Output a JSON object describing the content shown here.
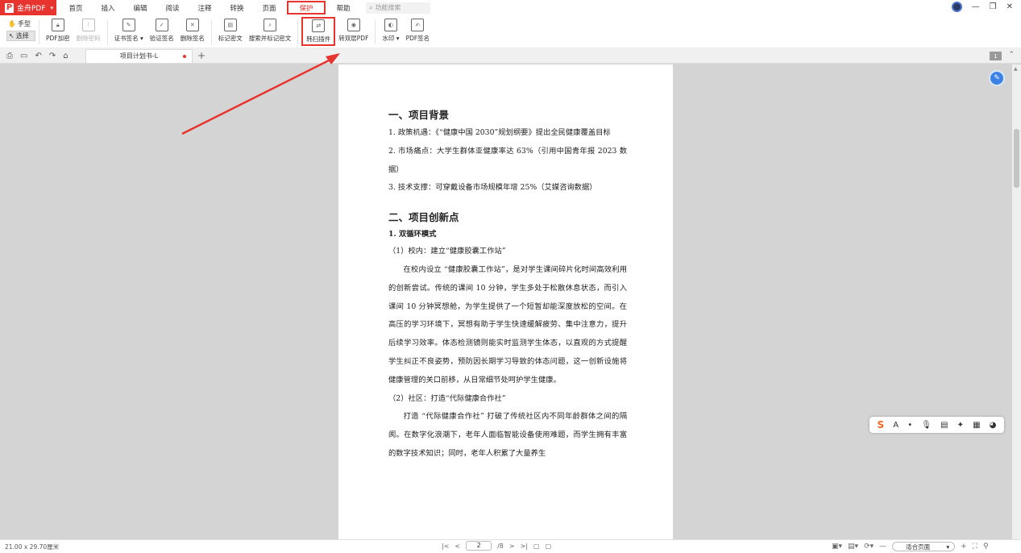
{
  "app": {
    "name": "金舟PDF",
    "logo_letter": "P"
  },
  "menu": {
    "tabs": [
      "首页",
      "插入",
      "编辑",
      "阅读",
      "注释",
      "转换",
      "页面",
      "保护",
      "帮助"
    ],
    "active": "保护",
    "search_placeholder": "功能搜索"
  },
  "ribbon": {
    "hand_label": "手型",
    "select_label": "选择",
    "buttons": [
      {
        "label": "PDF加密",
        "icon": "lock-shield-icon",
        "enabled": true
      },
      {
        "label": "删除密码",
        "icon": "unlock-shield-icon",
        "enabled": false
      },
      {
        "label": "证书签名",
        "icon": "certificate-sign-icon",
        "enabled": true,
        "dropdown": true
      },
      {
        "label": "验证签名",
        "icon": "verify-signature-icon",
        "enabled": true
      },
      {
        "label": "删除签名",
        "icon": "delete-signature-icon",
        "enabled": true
      },
      {
        "label": "标记密文",
        "icon": "mark-redaction-icon",
        "enabled": true
      },
      {
        "label": "搜索并标记密文",
        "icon": "search-redaction-icon",
        "enabled": true
      },
      {
        "label": "韩扫插件",
        "icon": "scan-plugin-icon",
        "enabled": true,
        "highlighted": true
      },
      {
        "label": "转双层PDF",
        "icon": "double-layer-pdf-icon",
        "enabled": true
      },
      {
        "label": "水印",
        "icon": "watermark-icon",
        "enabled": true,
        "dropdown": true
      },
      {
        "label": "PDF签名",
        "icon": "pdf-sign-icon",
        "enabled": true
      }
    ]
  },
  "tabs": {
    "document_title": "项目计划书-L",
    "modified": true,
    "page_count_badge": "1"
  },
  "document": {
    "sections": [
      {
        "heading": "一、项目背景",
        "blocks": [
          {
            "type": "p",
            "text": "1. 政策机遇：《“健康中国 2030”规划纲要》提出全民健康覆盖目标"
          },
          {
            "type": "p",
            "text": "2. 市场痛点：大学生群体亚健康率达 63%（引用中国青年报 2023 数据）"
          },
          {
            "type": "p",
            "text": "3. 技术支撑：可穿戴设备市场规模年增 25%（艾媒咨询数据）"
          }
        ]
      },
      {
        "heading": "二、项目创新点",
        "blocks": [
          {
            "type": "h3",
            "text": "1. 双循环模式"
          },
          {
            "type": "p",
            "text": "（1）校内：建立“健康胶囊工作站”"
          },
          {
            "type": "pi",
            "text": "在校内设立 “健康胶囊工作站”，是对学生课间碎片化时间高效利用的创新尝试。传统的课间 10 分钟，学生多处于松散休息状态，而引入课间 10 分钟冥想舱，为学生提供了一个短暂却能深度放松的空间。在高压的学习环境下，冥想有助于学生快速缓解疲劳、集中注意力，提升后续学习效率。体态检测镜则能实时监测学生体态，以直观的方式提醒学生纠正不良姿势，预防因长期学习导致的体态问题，这一创新设施将健康管理的关口前移，从日常细节处呵护学生健康。"
          },
          {
            "type": "p",
            "text": "（2）社区：打造“代际健康合作社”"
          },
          {
            "type": "pi",
            "text": "打造 “代际健康合作社” 打破了传统社区内不同年龄群体之间的隔阂。在数字化浪潮下，老年人面临智能设备使用难题，而学生拥有丰富的数字技术知识；同时，老年人积累了大量养生"
          }
        ]
      }
    ]
  },
  "status": {
    "page_size": "21.00 x 29.70厘米",
    "current_page": "2",
    "total_pages": "/8",
    "zoom": "适合页面"
  }
}
